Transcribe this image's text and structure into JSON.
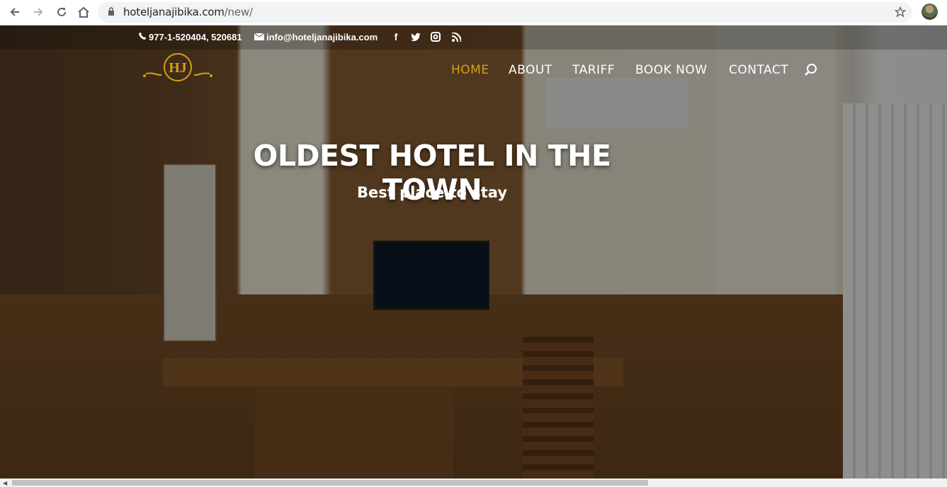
{
  "browser": {
    "url_host": "hoteljanajibika.com",
    "url_path": "/new/",
    "icons": [
      "back-arrow-icon",
      "forward-arrow-icon",
      "reload-icon",
      "home-icon",
      "lock-icon",
      "star-icon",
      "profile-avatar"
    ]
  },
  "topbar": {
    "phone": "977-1-520404, 520681",
    "email": "info@hoteljanajibika.com",
    "social": [
      "facebook-icon",
      "twitter-icon",
      "instagram-icon",
      "rss-icon"
    ]
  },
  "logo": {
    "text": "HJ"
  },
  "nav": {
    "items": [
      {
        "label": "HOME",
        "active": true
      },
      {
        "label": "ABOUT",
        "active": false
      },
      {
        "label": "TARIFF",
        "active": false
      },
      {
        "label": "BOOK NOW",
        "active": false
      },
      {
        "label": "CONTACT",
        "active": false
      }
    ]
  },
  "hero": {
    "title": "OLDEST HOTEL IN THE TOWN",
    "subtitle": "Best place to stay"
  },
  "colors": {
    "accent": "#d4a017",
    "text": "#ffffff"
  }
}
